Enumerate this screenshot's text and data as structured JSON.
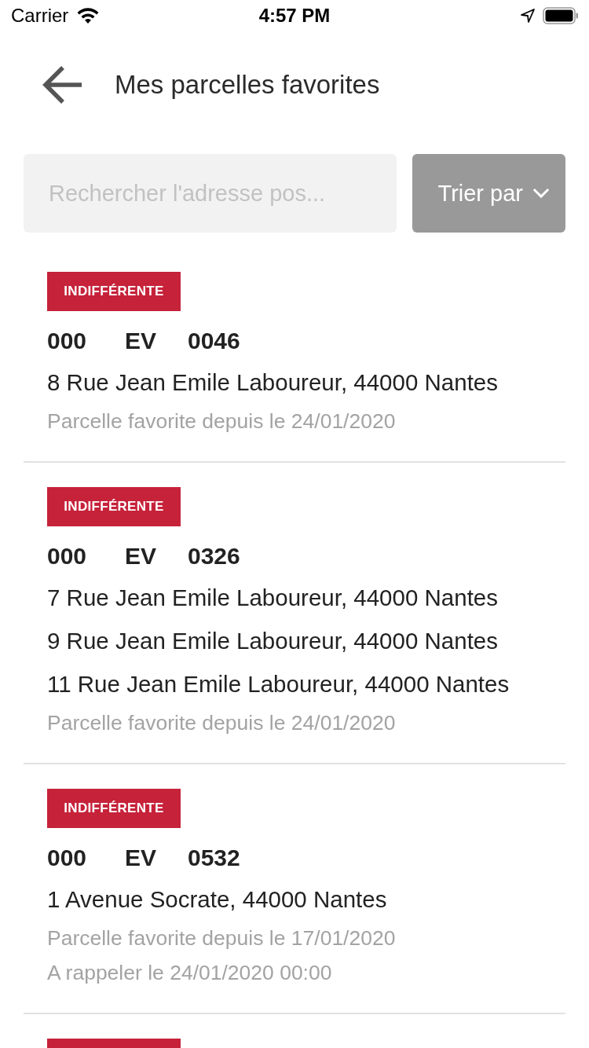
{
  "status_bar": {
    "carrier": "Carrier",
    "time": "4:57 PM"
  },
  "header": {
    "title": "Mes parcelles favorites"
  },
  "search": {
    "placeholder": "Rechercher l'adresse pos..."
  },
  "sort_button": {
    "label": "Trier par"
  },
  "parcels": [
    {
      "kind": "full",
      "tag": "INDIFFÉRENTE",
      "prefix": "000",
      "section": "EV",
      "number": "0046",
      "addresses": [
        "8 Rue Jean Emile Laboureur, 44000 Nantes"
      ],
      "notes": [
        "Parcelle favorite depuis le 24/01/2020"
      ]
    },
    {
      "kind": "full",
      "tag": "INDIFFÉRENTE",
      "prefix": "000",
      "section": "EV",
      "number": "0326",
      "addresses": [
        "7 Rue Jean Emile Laboureur, 44000 Nantes",
        "9 Rue Jean Emile Laboureur, 44000 Nantes",
        "11 Rue Jean Emile Laboureur, 44000 Nantes"
      ],
      "notes": [
        "Parcelle favorite depuis le 24/01/2020"
      ]
    },
    {
      "kind": "full",
      "tag": "INDIFFÉRENTE",
      "prefix": "000",
      "section": "EV",
      "number": "0532",
      "addresses": [
        "1 Avenue Socrate, 44000 Nantes"
      ],
      "notes": [
        "Parcelle favorite depuis le 17/01/2020",
        "A rappeler le 24/01/2020 00:00"
      ]
    },
    {
      "kind": "partial"
    }
  ]
}
